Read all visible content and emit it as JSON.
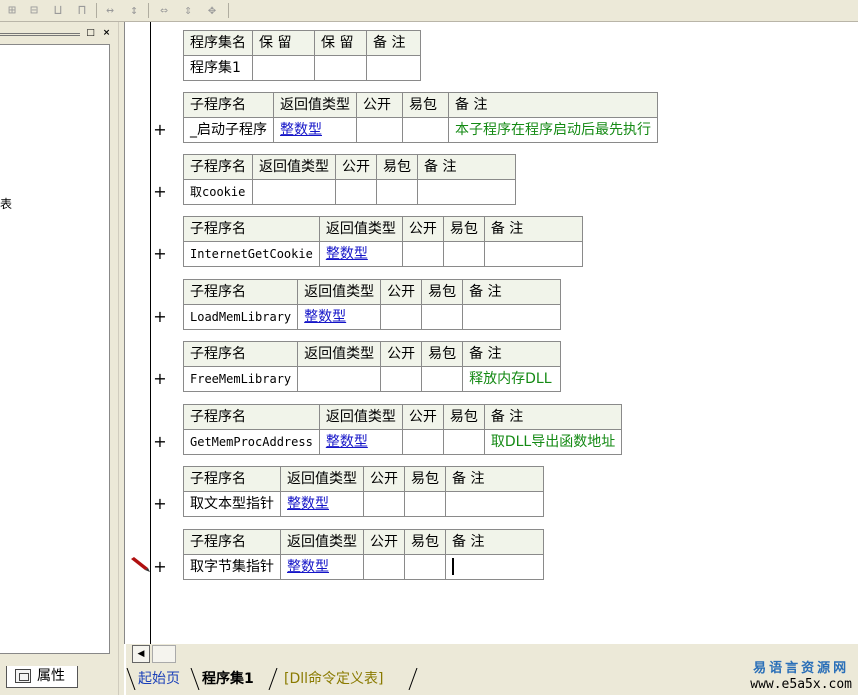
{
  "toolbar": {
    "icons": [
      "insert-row-icon",
      "insert-column-icon",
      "merge-icon",
      "split-icon",
      "align-width-icon",
      "align-height-icon",
      "fit-width-icon",
      "fit-height-icon",
      "fit-both-icon"
    ]
  },
  "left_panel": {
    "restore_button": "□",
    "close_button": "×",
    "fragment_char": "表",
    "properties_tab_label": "属性"
  },
  "editor": {
    "assembly_table": {
      "headers": [
        "程序集名",
        "保 留",
        "保 留",
        "备 注"
      ],
      "name": "程序集1"
    },
    "sub_header": {
      "name": "子程序名",
      "return_type": "返回值类型",
      "public": "公开",
      "easy_pack": "易包",
      "note": "备 注"
    },
    "subroutines": [
      {
        "name": "_启动子程序",
        "return_type": "整数型",
        "note": "本子程序在程序启动后最先执行",
        "toggle": "+"
      },
      {
        "name": "取cookie",
        "return_type": "",
        "note": "",
        "toggle": "+"
      },
      {
        "name": "InternetGetCookie",
        "return_type": "整数型",
        "note": "",
        "toggle": "+"
      },
      {
        "name": "LoadMemLibrary",
        "return_type": "整数型",
        "note": "",
        "toggle": "+"
      },
      {
        "name": "FreeMemLibrary",
        "return_type": "",
        "note": "释放内存DLL",
        "toggle": "+"
      },
      {
        "name": "GetMemProcAddress",
        "return_type": "整数型",
        "note": "取DLL导出函数地址",
        "toggle": "+"
      },
      {
        "name": "取文本型指针",
        "return_type": "整数型",
        "note": "",
        "toggle": "+"
      },
      {
        "name": "取字节集指针",
        "return_type": "整数型",
        "note": "",
        "toggle": "+"
      }
    ]
  },
  "scrollbar": {
    "left_arrow": "◀"
  },
  "tabs": {
    "home": "起始页",
    "current": "程序集1",
    "dll": "[Dll命令定义表]"
  },
  "watermark": {
    "line1": "易语言资源网",
    "line2": "www.e5a5x.com"
  },
  "colors": {
    "header_bg": "#f1f4ea",
    "type_link": "#1515c8",
    "note_green": "#148a14",
    "chrome": "#ece9d8"
  }
}
